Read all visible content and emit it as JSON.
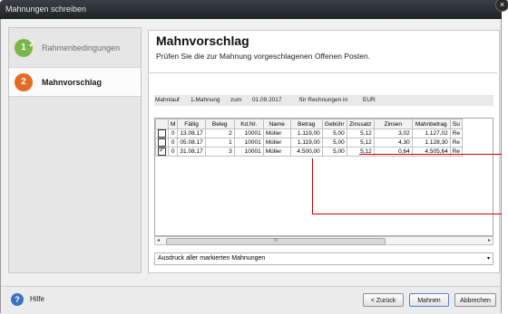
{
  "window": {
    "title": "Mahnungen schreiben",
    "close_glyph": "×"
  },
  "sidebar": {
    "steps": [
      {
        "number": "1",
        "label": "Rahmenbedingungen",
        "state": "done"
      },
      {
        "number": "2",
        "label": "Mahnvorschlag",
        "state": "active"
      }
    ]
  },
  "main": {
    "title": "Mahnvorschlag",
    "subtitle": "Prüfen Sie die zur Mahnung vorgeschlagenen Offenen Posten.",
    "info": {
      "label": "Mahnlauf",
      "level": "1.Mahnung",
      "at_label": "zum",
      "date": "01.09.2017",
      "for_label": "für Rechnungen in",
      "currency": "EUR"
    },
    "table": {
      "columns": [
        "",
        "M",
        "Fällig",
        "Beleg",
        "Kd.Nr.",
        "Name",
        "Betrag",
        "Gebühr",
        "Zinssatz",
        "Zinsen",
        "Mahnbetrag",
        "Su"
      ],
      "rows": [
        {
          "checked": false,
          "cells": [
            "0",
            "13.08.17",
            "2",
            "10001",
            "Müller",
            "1.119,00",
            "5,00",
            "5,12",
            "3,02",
            "1.127,02",
            "Re"
          ]
        },
        {
          "checked": false,
          "cells": [
            "0",
            "05.08.17",
            "1",
            "10001",
            "Müller",
            "1.119,00",
            "5,00",
            "5,12",
            "4,30",
            "1.128,30",
            "Re"
          ]
        },
        {
          "checked": true,
          "cells": [
            "0",
            "31.08.17",
            "3",
            "10001",
            "Müller",
            "4.500,00",
            "5,00",
            "5,12",
            "0,64",
            "4.505,64",
            "Re"
          ]
        }
      ]
    },
    "scrollbar": {
      "thumb_grip": "III",
      "left_arrow": "◂",
      "right_arrow": "▸"
    },
    "print_option": {
      "value": "Ausdruck aller markierten Mahnungen",
      "arrow": "▾"
    }
  },
  "footer": {
    "help_label": "Hilfe",
    "help_glyph": "?",
    "back_label": "< Zurück",
    "send_label": "Mahnen",
    "cancel_label": "Abbrechen"
  },
  "colors": {
    "accent_green": "#7ab648",
    "accent_orange": "#e46b24",
    "callout_red": "#d00000",
    "help_blue": "#3b73c4"
  }
}
